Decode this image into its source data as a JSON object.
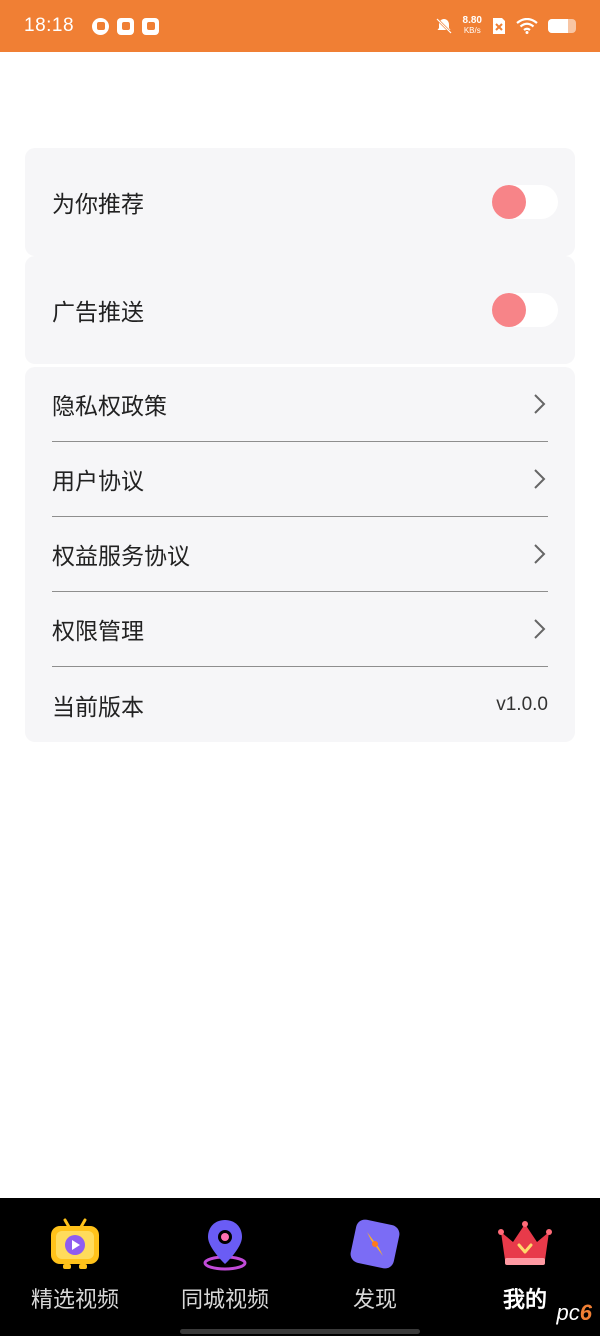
{
  "status_bar": {
    "time": "18:18",
    "net_speed_value": "8.80",
    "net_speed_unit": "KB/s",
    "battery_level": 0.7,
    "icons": [
      "speedometer-icon",
      "mail-icon",
      "app-badge-icon",
      "mute-icon",
      "sim-off-icon",
      "wifi-icon",
      "battery-icon"
    ],
    "bg_color": "#f07f34"
  },
  "settings": {
    "recommend": {
      "label": "为你推荐",
      "enabled": false
    },
    "ads": {
      "label": "广告推送",
      "enabled": false
    },
    "privacy_label": "隐私权政策",
    "user_agreement_label": "用户协议",
    "benefits_agreement_label": "权益服务协议",
    "permissions_label": "权限管理",
    "version_label": "当前版本",
    "version_value": "v1.0.0"
  },
  "tabbar": {
    "tabs": [
      {
        "label": "精选视频",
        "icon": "video-play-icon",
        "active": false
      },
      {
        "label": "同城视频",
        "icon": "location-pin-icon",
        "active": false
      },
      {
        "label": "发现",
        "icon": "compass-icon",
        "active": false
      },
      {
        "label": "我的",
        "icon": "crown-icon",
        "active": true
      }
    ]
  },
  "watermark": {
    "prefix": "pc",
    "number": "6"
  },
  "colors": {
    "accent": "#f07f34",
    "toggle_knob": "#f78488",
    "card_bg": "#f6f6f8"
  }
}
